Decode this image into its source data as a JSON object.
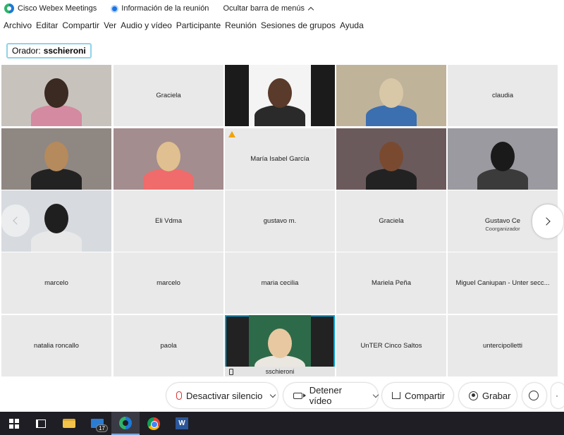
{
  "titlebar": {
    "app_name": "Cisco Webex Meetings",
    "meeting_info": "Información de la reunión",
    "hide_menu": "Ocultar barra de menús"
  },
  "menu": [
    "Archivo",
    "Editar",
    "Compartir",
    "Ver",
    "Audio y vídeo",
    "Participante",
    "Reunión",
    "Sesiones de grupos",
    "Ayuda"
  ],
  "speaker": {
    "label": "Orador:",
    "name": "sschieroni"
  },
  "participants": [
    {
      "name": "",
      "video": true
    },
    {
      "name": "Graciela",
      "video": false
    },
    {
      "name": "",
      "video": true
    },
    {
      "name": "",
      "video": true
    },
    {
      "name": "claudia",
      "video": false
    },
    {
      "name": "",
      "video": true
    },
    {
      "name": "",
      "video": true
    },
    {
      "name": "María Isabel García",
      "video": false,
      "warning": true
    },
    {
      "name": "",
      "video": true
    },
    {
      "name": "",
      "video": true
    },
    {
      "name": "",
      "video": true
    },
    {
      "name": "Eli Vdma",
      "video": false
    },
    {
      "name": "gustavo m.",
      "video": false
    },
    {
      "name": "Graciela",
      "video": false
    },
    {
      "name": "Gustavo Ce",
      "role": "Coorganizador",
      "video": false
    },
    {
      "name": "marcelo",
      "video": false
    },
    {
      "name": "marcelo",
      "video": false
    },
    {
      "name": "maria cecilia",
      "video": false
    },
    {
      "name": "Mariela Peña",
      "video": false
    },
    {
      "name": "Miguel Caniupan - Unter secc...",
      "video": false
    },
    {
      "name": "natalia roncallo",
      "video": false
    },
    {
      "name": "paola",
      "video": false
    },
    {
      "name": "sschieroni",
      "video": true,
      "active": true
    },
    {
      "name": "UnTER Cinco Saltos",
      "video": false
    },
    {
      "name": "untercipolletti",
      "video": false
    }
  ],
  "controls": {
    "mute": "Desactivar silencio",
    "stop_video": "Detener vídeo",
    "share": "Compartir",
    "record": "Grabar"
  },
  "taskbar": {
    "mail_badge": "17",
    "word_letter": "W"
  },
  "colors": {
    "accent": "#00a0d1",
    "mic_muted": "#dd3333",
    "taskbar": "#1e1e24"
  }
}
